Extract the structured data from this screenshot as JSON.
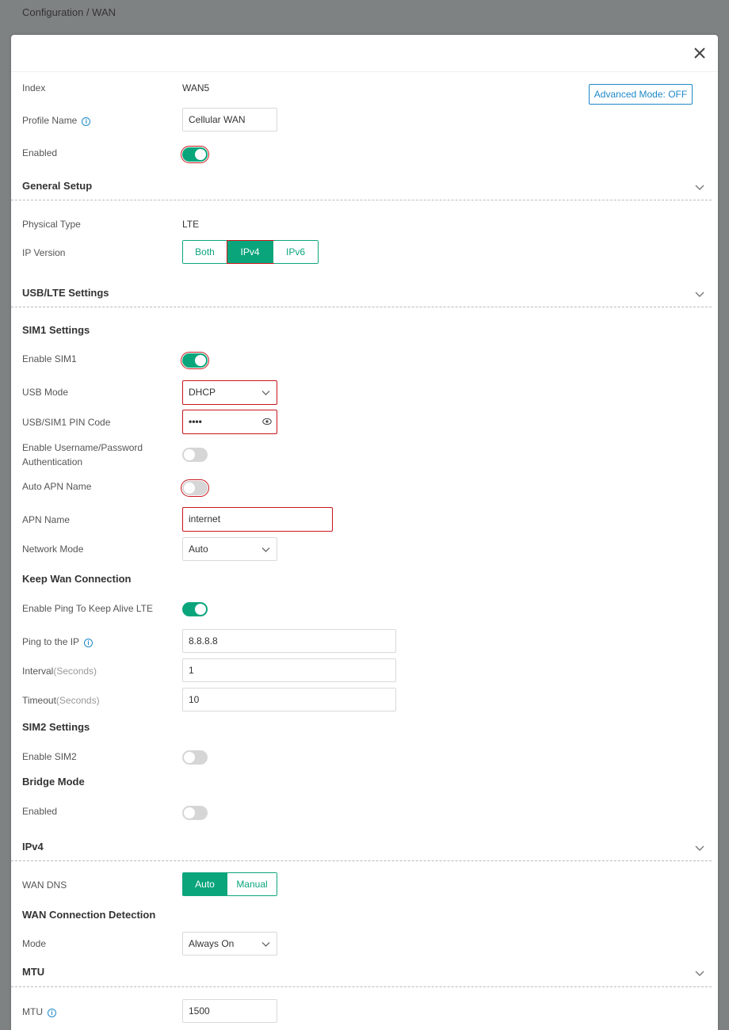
{
  "breadcrumb": "Configuration / WAN",
  "header": {
    "advanced_mode": "Advanced Mode: OFF"
  },
  "fields": {
    "index_label": "Index",
    "index_value": "WAN5",
    "profile_name_label": "Profile Name",
    "profile_name_value": "Cellular WAN",
    "enabled_label": "Enabled",
    "enabled_on": true
  },
  "general_setup": {
    "title": "General Setup",
    "physical_type_label": "Physical Type",
    "physical_type_value": "LTE",
    "ip_version_label": "IP Version",
    "ip_version_options": [
      "Both",
      "IPv4",
      "IPv6"
    ],
    "ip_version_selected": "IPv4"
  },
  "usb_lte": {
    "title": "USB/LTE Settings",
    "sim1_title": "SIM1 Settings",
    "enable_sim1_label": "Enable SIM1",
    "usb_mode_label": "USB Mode",
    "usb_mode_value": "DHCP",
    "pin_label": "USB/SIM1 PIN Code",
    "pin_value": "••••",
    "auth_label_line1": "Enable Username/Password",
    "auth_label_line2": "Authentication",
    "auto_apn_label": "Auto APN Name",
    "apn_label": "APN Name",
    "apn_value": "internet",
    "network_mode_label": "Network Mode",
    "network_mode_value": "Auto"
  },
  "keep_wan": {
    "title": "Keep Wan Connection",
    "ping_keepalive_label": "Enable Ping To Keep Alive LTE",
    "ping_ip_label": "Ping to the IP",
    "ping_ip_value": "8.8.8.8",
    "interval_label": "Interval",
    "interval_unit": "(Seconds)",
    "interval_value": "1",
    "timeout_label": "Timeout",
    "timeout_unit": "(Seconds)",
    "timeout_value": "10"
  },
  "sim2": {
    "title": "SIM2 Settings",
    "enable_sim2_label": "Enable SIM2"
  },
  "bridge": {
    "title": "Bridge Mode",
    "enabled_label": "Enabled"
  },
  "ipv4": {
    "title": "IPv4",
    "wan_dns_label": "WAN DNS",
    "wan_dns_options": [
      "Auto",
      "Manual"
    ],
    "wan_dns_selected": "Auto"
  },
  "detection": {
    "title": "WAN Connection Detection",
    "mode_label": "Mode",
    "mode_value": "Always On"
  },
  "mtu": {
    "title": "MTU",
    "mtu_label": "MTU",
    "mtu_value": "1500"
  },
  "colors": {
    "accent": "#0ba57c",
    "highlight": "#c8161d",
    "link": "#1e88c8"
  }
}
